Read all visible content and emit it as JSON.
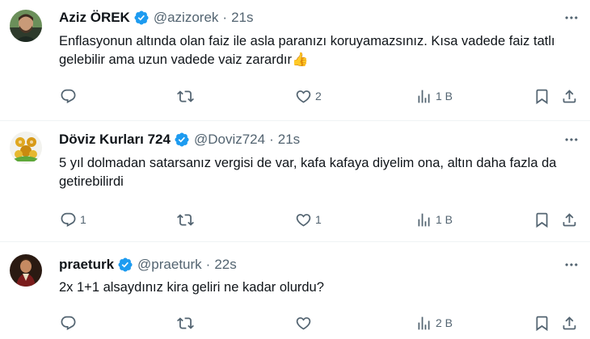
{
  "tweets": [
    {
      "name": "Aziz ÖREK",
      "handle": "@azizorek",
      "separator": "·",
      "time": "21s",
      "text": "Enflasyonun altında olan faiz ile asla paranızı koruyamazsınız. Kısa vadede faiz tatlı gelebilir ama uzun vadede vaiz zarardır👍",
      "replies": "",
      "retweets": "",
      "likes": "2",
      "views": "1 B"
    },
    {
      "name": "Döviz Kurları 724",
      "handle": "@Doviz724",
      "separator": "·",
      "time": "21s",
      "text": "5 yıl dolmadan satarsanız vergisi de var, kafa kafaya diyelim ona, altın daha fazla da getirebilirdi",
      "replies": "1",
      "retweets": "",
      "likes": "1",
      "views": "1 B"
    },
    {
      "name": "praeturk",
      "handle": "@praeturk",
      "separator": "·",
      "time": "22s",
      "text": "2x 1+1 alsaydınız kira geliri ne kadar olurdu?",
      "replies": "",
      "retweets": "",
      "likes": "",
      "views": "2 B"
    }
  ],
  "colors": {
    "text": "#0f1419",
    "secondary": "#536471",
    "verified": "#1d9bf0",
    "divider": "#eff3f4"
  },
  "icons": [
    "reply-icon",
    "retweet-icon",
    "like-icon",
    "views-icon",
    "bookmark-icon",
    "share-icon",
    "more-icon",
    "verified-badge-icon"
  ]
}
